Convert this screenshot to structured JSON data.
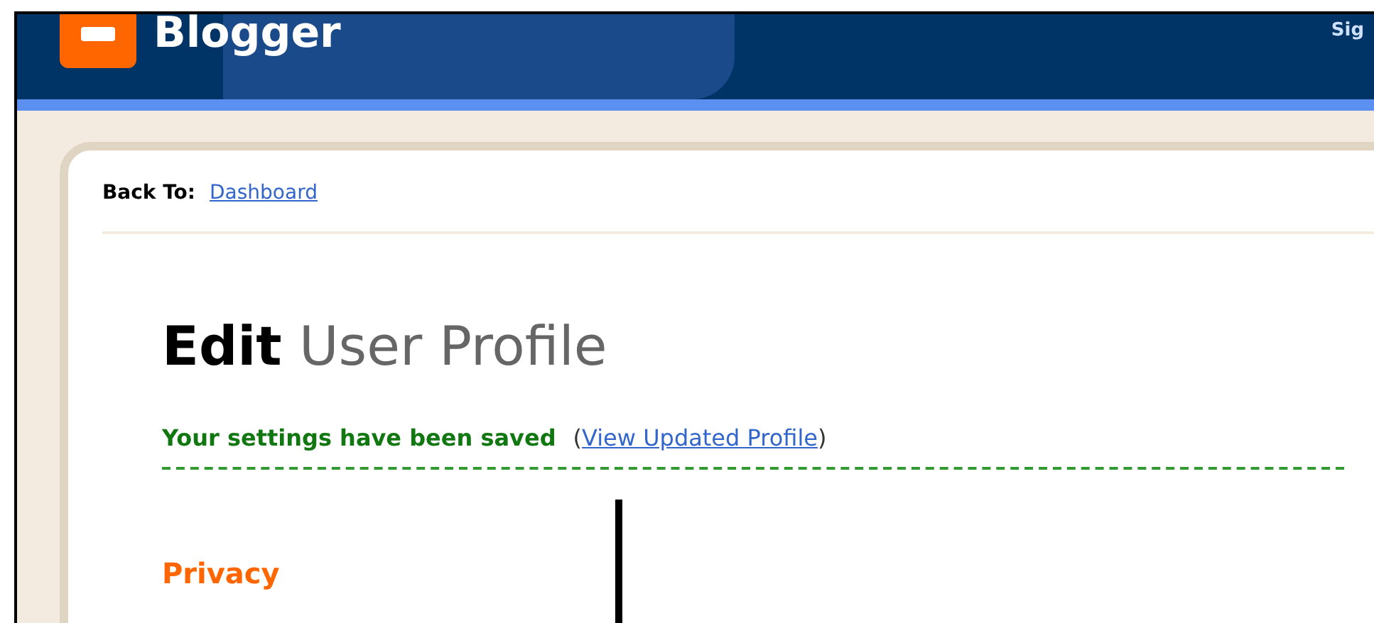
{
  "header": {
    "logo_text": "Blogger",
    "right_link": "Sig"
  },
  "back_to": {
    "label": "Back To:",
    "link": "Dashboard"
  },
  "title": {
    "bold": "Edit",
    "rest": "User Profile"
  },
  "notice": {
    "message": "Your settings have been saved",
    "open": "(",
    "link": "View Updated Profile",
    "close": ")"
  },
  "section": {
    "heading": "Privacy"
  }
}
